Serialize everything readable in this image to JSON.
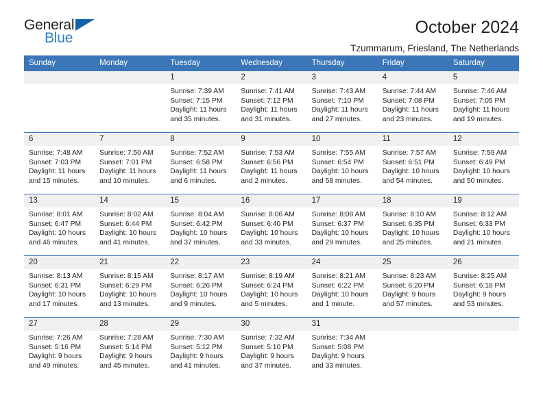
{
  "brand": {
    "name_top": "General",
    "name_bottom": "Blue",
    "accent_color": "#1263ad",
    "blue_text_color": "#2e7dc4"
  },
  "header": {
    "title": "October 2024",
    "subtitle": "Tzummarum, Friesland, The Netherlands"
  },
  "calendar": {
    "header_bg": "#3a76b8",
    "daynum_bg": "#f0f0f0",
    "weekdays": [
      "Sunday",
      "Monday",
      "Tuesday",
      "Wednesday",
      "Thursday",
      "Friday",
      "Saturday"
    ],
    "weeks": [
      [
        {
          "day": "",
          "sunrise": "",
          "sunset": "",
          "daylight": ""
        },
        {
          "day": "",
          "sunrise": "",
          "sunset": "",
          "daylight": ""
        },
        {
          "day": "1",
          "sunrise": "Sunrise: 7:39 AM",
          "sunset": "Sunset: 7:15 PM",
          "daylight": "Daylight: 11 hours and 35 minutes."
        },
        {
          "day": "2",
          "sunrise": "Sunrise: 7:41 AM",
          "sunset": "Sunset: 7:12 PM",
          "daylight": "Daylight: 11 hours and 31 minutes."
        },
        {
          "day": "3",
          "sunrise": "Sunrise: 7:43 AM",
          "sunset": "Sunset: 7:10 PM",
          "daylight": "Daylight: 11 hours and 27 minutes."
        },
        {
          "day": "4",
          "sunrise": "Sunrise: 7:44 AM",
          "sunset": "Sunset: 7:08 PM",
          "daylight": "Daylight: 11 hours and 23 minutes."
        },
        {
          "day": "5",
          "sunrise": "Sunrise: 7:46 AM",
          "sunset": "Sunset: 7:05 PM",
          "daylight": "Daylight: 11 hours and 19 minutes."
        }
      ],
      [
        {
          "day": "6",
          "sunrise": "Sunrise: 7:48 AM",
          "sunset": "Sunset: 7:03 PM",
          "daylight": "Daylight: 11 hours and 15 minutes."
        },
        {
          "day": "7",
          "sunrise": "Sunrise: 7:50 AM",
          "sunset": "Sunset: 7:01 PM",
          "daylight": "Daylight: 11 hours and 10 minutes."
        },
        {
          "day": "8",
          "sunrise": "Sunrise: 7:52 AM",
          "sunset": "Sunset: 6:58 PM",
          "daylight": "Daylight: 11 hours and 6 minutes."
        },
        {
          "day": "9",
          "sunrise": "Sunrise: 7:53 AM",
          "sunset": "Sunset: 6:56 PM",
          "daylight": "Daylight: 11 hours and 2 minutes."
        },
        {
          "day": "10",
          "sunrise": "Sunrise: 7:55 AM",
          "sunset": "Sunset: 6:54 PM",
          "daylight": "Daylight: 10 hours and 58 minutes."
        },
        {
          "day": "11",
          "sunrise": "Sunrise: 7:57 AM",
          "sunset": "Sunset: 6:51 PM",
          "daylight": "Daylight: 10 hours and 54 minutes."
        },
        {
          "day": "12",
          "sunrise": "Sunrise: 7:59 AM",
          "sunset": "Sunset: 6:49 PM",
          "daylight": "Daylight: 10 hours and 50 minutes."
        }
      ],
      [
        {
          "day": "13",
          "sunrise": "Sunrise: 8:01 AM",
          "sunset": "Sunset: 6:47 PM",
          "daylight": "Daylight: 10 hours and 46 minutes."
        },
        {
          "day": "14",
          "sunrise": "Sunrise: 8:02 AM",
          "sunset": "Sunset: 6:44 PM",
          "daylight": "Daylight: 10 hours and 41 minutes."
        },
        {
          "day": "15",
          "sunrise": "Sunrise: 8:04 AM",
          "sunset": "Sunset: 6:42 PM",
          "daylight": "Daylight: 10 hours and 37 minutes."
        },
        {
          "day": "16",
          "sunrise": "Sunrise: 8:06 AM",
          "sunset": "Sunset: 6:40 PM",
          "daylight": "Daylight: 10 hours and 33 minutes."
        },
        {
          "day": "17",
          "sunrise": "Sunrise: 8:08 AM",
          "sunset": "Sunset: 6:37 PM",
          "daylight": "Daylight: 10 hours and 29 minutes."
        },
        {
          "day": "18",
          "sunrise": "Sunrise: 8:10 AM",
          "sunset": "Sunset: 6:35 PM",
          "daylight": "Daylight: 10 hours and 25 minutes."
        },
        {
          "day": "19",
          "sunrise": "Sunrise: 8:12 AM",
          "sunset": "Sunset: 6:33 PM",
          "daylight": "Daylight: 10 hours and 21 minutes."
        }
      ],
      [
        {
          "day": "20",
          "sunrise": "Sunrise: 8:13 AM",
          "sunset": "Sunset: 6:31 PM",
          "daylight": "Daylight: 10 hours and 17 minutes."
        },
        {
          "day": "21",
          "sunrise": "Sunrise: 8:15 AM",
          "sunset": "Sunset: 6:29 PM",
          "daylight": "Daylight: 10 hours and 13 minutes."
        },
        {
          "day": "22",
          "sunrise": "Sunrise: 8:17 AM",
          "sunset": "Sunset: 6:26 PM",
          "daylight": "Daylight: 10 hours and 9 minutes."
        },
        {
          "day": "23",
          "sunrise": "Sunrise: 8:19 AM",
          "sunset": "Sunset: 6:24 PM",
          "daylight": "Daylight: 10 hours and 5 minutes."
        },
        {
          "day": "24",
          "sunrise": "Sunrise: 8:21 AM",
          "sunset": "Sunset: 6:22 PM",
          "daylight": "Daylight: 10 hours and 1 minute."
        },
        {
          "day": "25",
          "sunrise": "Sunrise: 8:23 AM",
          "sunset": "Sunset: 6:20 PM",
          "daylight": "Daylight: 9 hours and 57 minutes."
        },
        {
          "day": "26",
          "sunrise": "Sunrise: 8:25 AM",
          "sunset": "Sunset: 6:18 PM",
          "daylight": "Daylight: 9 hours and 53 minutes."
        }
      ],
      [
        {
          "day": "27",
          "sunrise": "Sunrise: 7:26 AM",
          "sunset": "Sunset: 5:16 PM",
          "daylight": "Daylight: 9 hours and 49 minutes."
        },
        {
          "day": "28",
          "sunrise": "Sunrise: 7:28 AM",
          "sunset": "Sunset: 5:14 PM",
          "daylight": "Daylight: 9 hours and 45 minutes."
        },
        {
          "day": "29",
          "sunrise": "Sunrise: 7:30 AM",
          "sunset": "Sunset: 5:12 PM",
          "daylight": "Daylight: 9 hours and 41 minutes."
        },
        {
          "day": "30",
          "sunrise": "Sunrise: 7:32 AM",
          "sunset": "Sunset: 5:10 PM",
          "daylight": "Daylight: 9 hours and 37 minutes."
        },
        {
          "day": "31",
          "sunrise": "Sunrise: 7:34 AM",
          "sunset": "Sunset: 5:08 PM",
          "daylight": "Daylight: 9 hours and 33 minutes."
        },
        {
          "day": "",
          "sunrise": "",
          "sunset": "",
          "daylight": ""
        },
        {
          "day": "",
          "sunrise": "",
          "sunset": "",
          "daylight": ""
        }
      ]
    ]
  }
}
